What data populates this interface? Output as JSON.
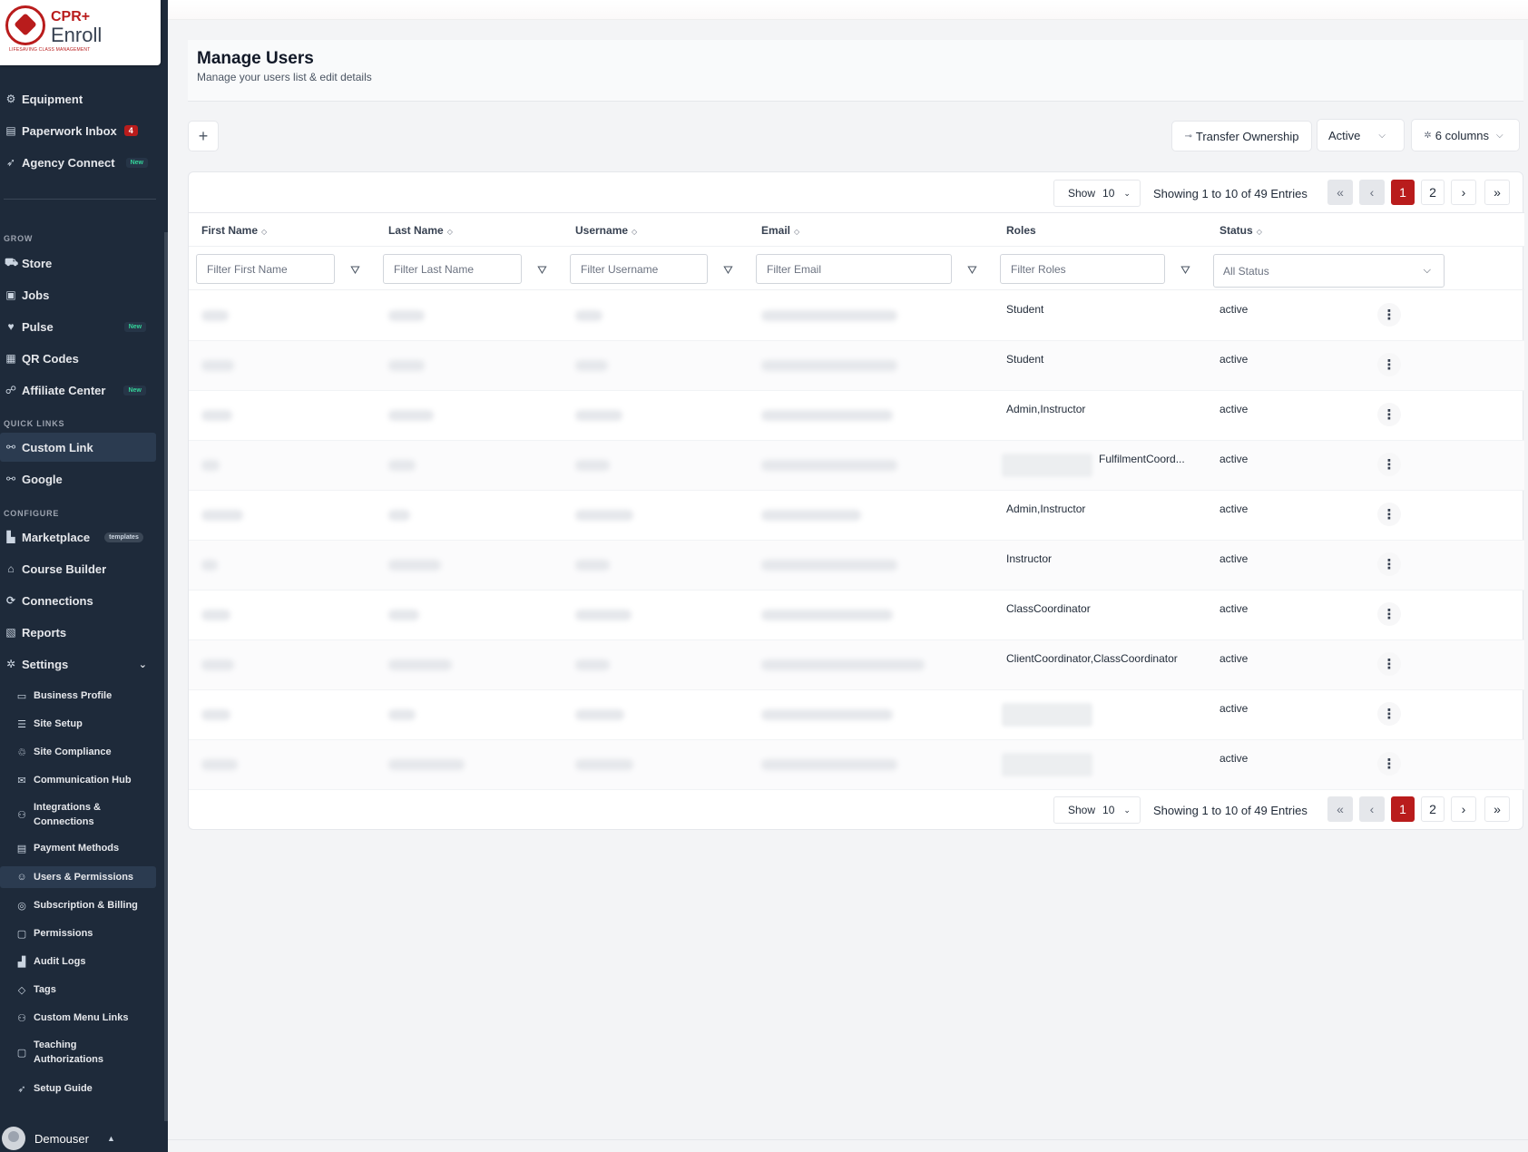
{
  "brand": {
    "line1": "CPR+",
    "line2": "Enroll",
    "tagline": "LIFESAVING CLASS MANAGEMENT"
  },
  "sidebar": {
    "top_items": [
      {
        "label": "Equipment",
        "icon": "equipment-icon"
      },
      {
        "label": "Paperwork Inbox",
        "icon": "inbox-icon",
        "badge": "4"
      },
      {
        "label": "Agency Connect",
        "icon": "rocket-icon",
        "badge_new": "New"
      }
    ],
    "sections": {
      "grow": "GROW",
      "quick_links": "QUICK LINKS",
      "configure": "CONFIGURE"
    },
    "grow_items": [
      {
        "label": "Store",
        "icon": "cart-icon"
      },
      {
        "label": "Jobs",
        "icon": "briefcase-icon"
      },
      {
        "label": "Pulse",
        "icon": "heart-pulse-icon",
        "badge_new": "New"
      },
      {
        "label": "QR Codes",
        "icon": "qr-code-icon"
      },
      {
        "label": "Affiliate Center",
        "icon": "handshake-icon",
        "badge_new": "New"
      }
    ],
    "quick_items": [
      {
        "label": "Custom Link",
        "icon": "link-icon"
      },
      {
        "label": "Google",
        "icon": "link-icon"
      }
    ],
    "configure_items": [
      {
        "label": "Marketplace",
        "icon": "shop-icon",
        "badge_tpl": "templates"
      },
      {
        "label": "Course Builder",
        "icon": "graduation-cap-icon"
      },
      {
        "label": "Connections",
        "icon": "connections-icon"
      },
      {
        "label": "Reports",
        "icon": "report-icon"
      },
      {
        "label": "Settings",
        "icon": "gear-icon"
      }
    ],
    "settings_items": [
      {
        "label": "Business Profile"
      },
      {
        "label": "Site Setup"
      },
      {
        "label": "Site Compliance"
      },
      {
        "label": "Communication Hub"
      },
      {
        "label": "Integrations & Connections"
      },
      {
        "label": "Payment Methods"
      },
      {
        "label": "Users & Permissions"
      },
      {
        "label": "Subscription & Billing"
      },
      {
        "label": "Permissions"
      },
      {
        "label": "Audit Logs"
      },
      {
        "label": "Tags"
      },
      {
        "label": "Custom Menu Links"
      },
      {
        "label": "Teaching Authorizations"
      },
      {
        "label": "Setup Guide"
      }
    ],
    "user": {
      "name": "Demouser"
    }
  },
  "page": {
    "title": "Manage Users",
    "subtitle": "Manage your users list & edit details"
  },
  "toolbar": {
    "add_label": "+",
    "transfer_label": "Transfer Ownership",
    "status_value": "Active",
    "columns_label": "6 columns"
  },
  "pagination": {
    "show_label": "Show",
    "page_size": "10",
    "showing_text": "Showing 1 to 10 of 49 Entries",
    "first": "«",
    "prev": "‹",
    "pages": [
      "1",
      "2"
    ],
    "next": "›",
    "last": "»"
  },
  "table": {
    "columns": [
      "First Name",
      "Last Name",
      "Username",
      "Email",
      "Roles",
      "Status"
    ],
    "filters": {
      "first_name": "Filter First Name",
      "last_name": "Filter Last Name",
      "username": "Filter Username",
      "email": "Filter Email",
      "roles": "Filter Roles",
      "status": "All Status"
    },
    "rows": [
      {
        "roles": "Student",
        "status": "active"
      },
      {
        "roles": "Student",
        "status": "active"
      },
      {
        "roles": "Admin,Instructor",
        "status": "active"
      },
      {
        "roles": "FulfilmentCoord...",
        "status": "active"
      },
      {
        "roles": "Admin,Instructor",
        "status": "active"
      },
      {
        "roles": "Instructor",
        "status": "active"
      },
      {
        "roles": "ClassCoordinator",
        "status": "active"
      },
      {
        "roles": "ClientCoordinator,ClassCoordinator",
        "status": "active"
      },
      {
        "roles": "",
        "status": "active"
      },
      {
        "roles": "",
        "status": "active"
      }
    ]
  }
}
